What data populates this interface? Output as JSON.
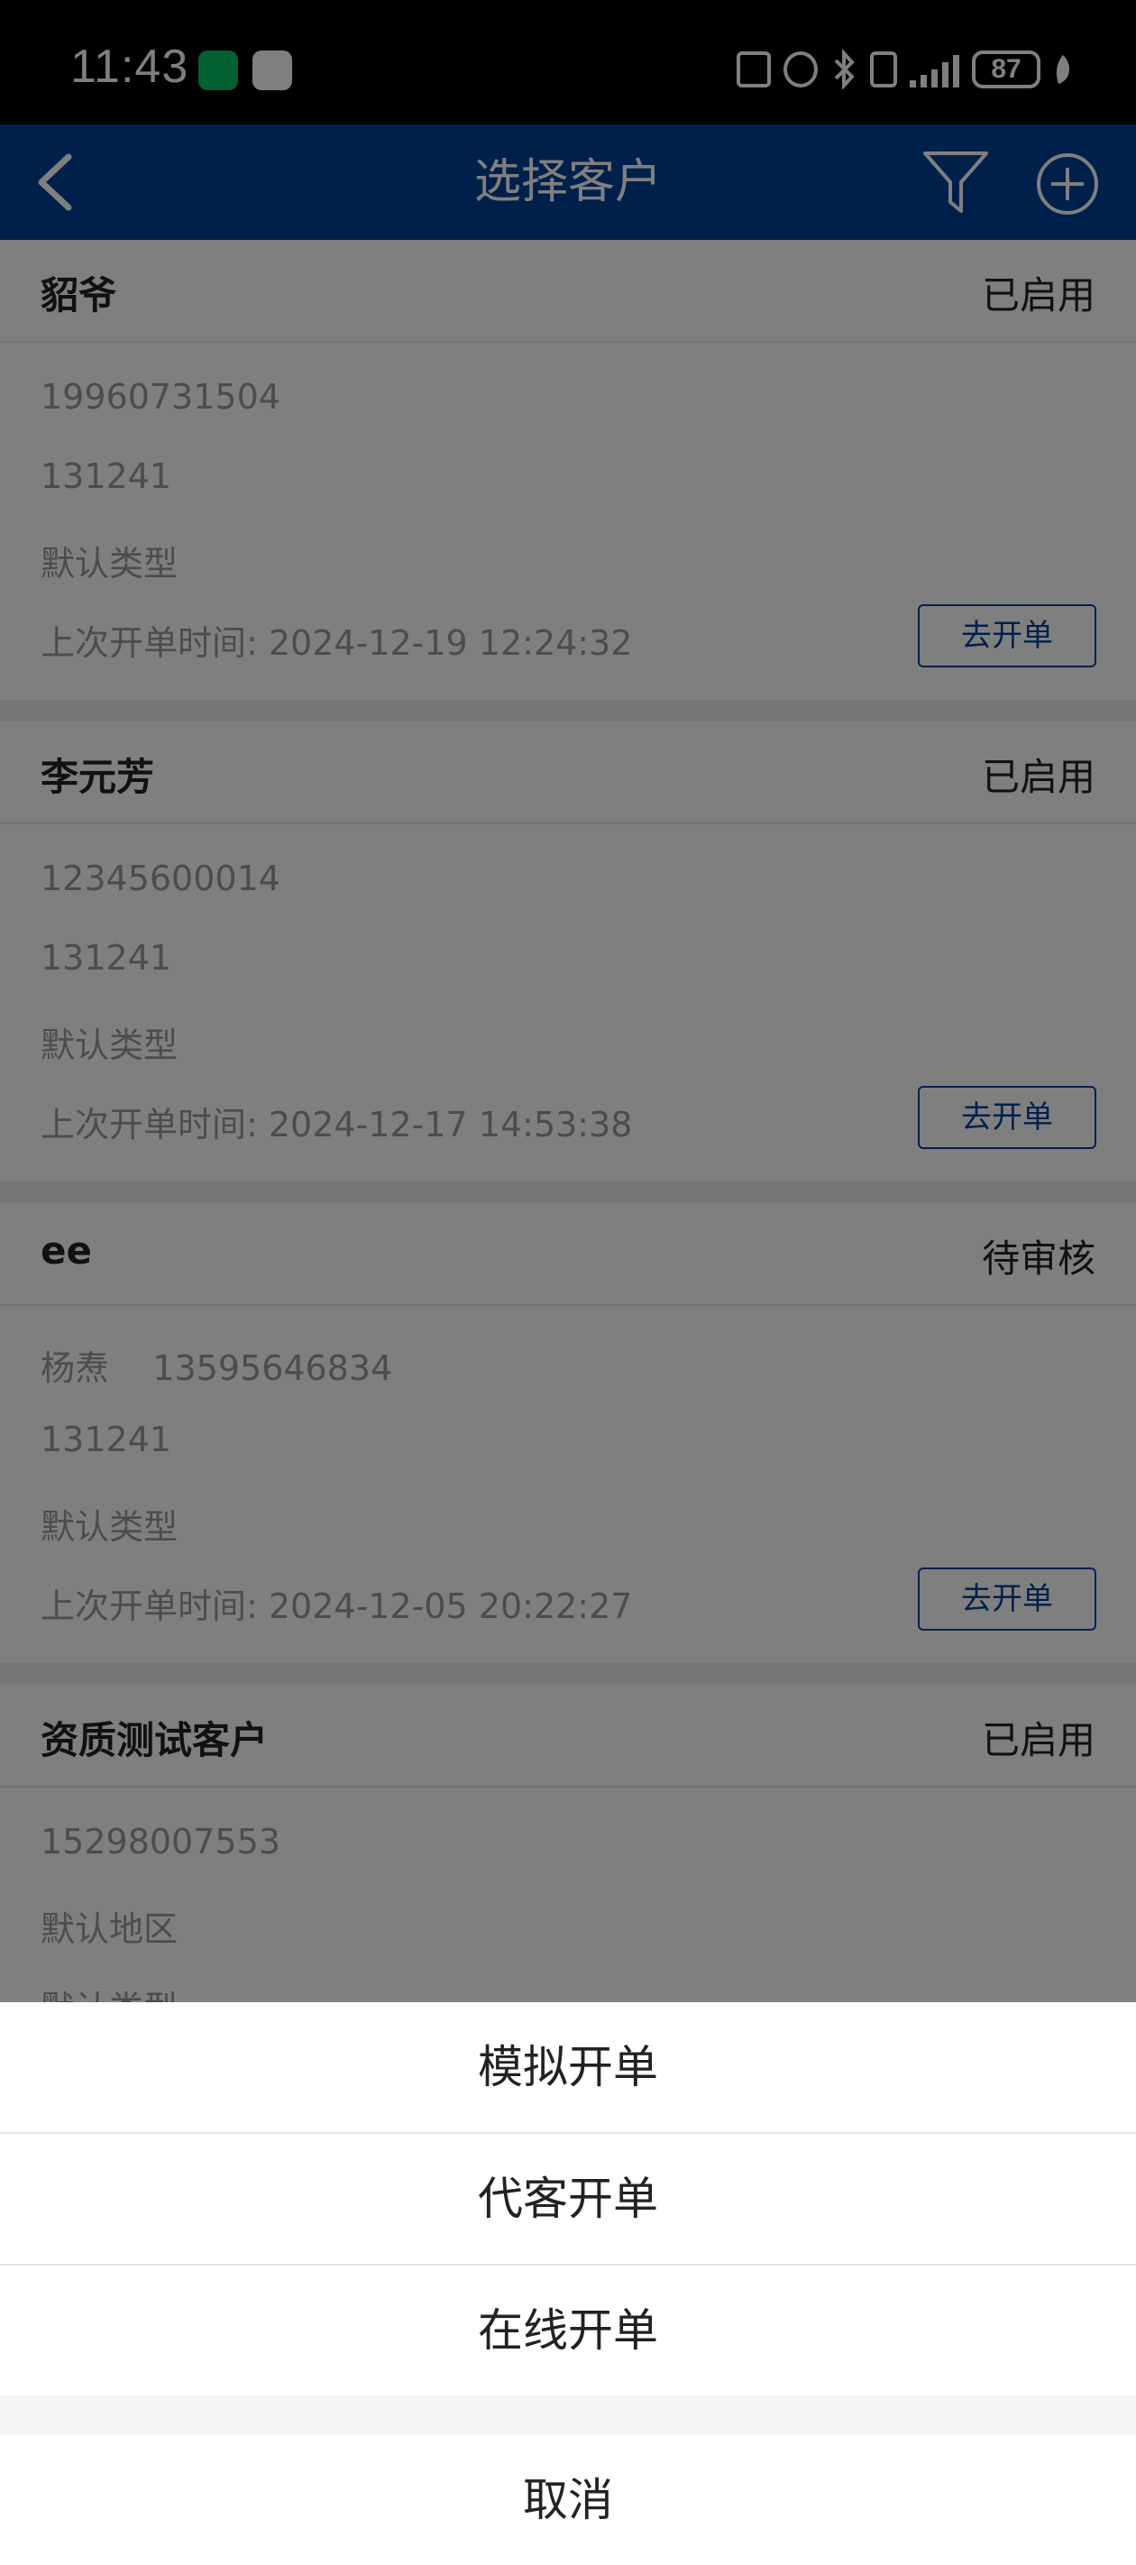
{
  "status_bar": {
    "time": "11:43",
    "battery": "87",
    "icons": [
      "wechat-icon",
      "message-icon",
      "nfc-icon",
      "alarm-icon",
      "bluetooth-icon",
      "vibrate-icon",
      "signal-icon",
      "battery-icon",
      "leaf-icon"
    ]
  },
  "nav": {
    "title": "选择客户",
    "icons": [
      "back-arrow-icon",
      "filter-icon",
      "add-circle-icon"
    ]
  },
  "customers": [
    {
      "name": "貂爷",
      "status": "已启用",
      "lines": [
        "19960731504",
        "131241",
        "默认类型"
      ],
      "last_order": "上次开单时间:  2024-12-19 12:24:32",
      "button": "去开单"
    },
    {
      "name": "李元芳",
      "status": "已启用",
      "lines": [
        "12345600014",
        "131241",
        "默认类型"
      ],
      "last_order": "上次开单时间:  2024-12-17 14:53:38",
      "button": "去开单"
    },
    {
      "name": "ee",
      "status": "待审核",
      "lines": [
        "杨焘    13595646834",
        "131241",
        "默认类型"
      ],
      "last_order": "上次开单时间:  2024-12-05 20:22:27",
      "button": "去开单"
    },
    {
      "name": "资质测试客户",
      "status": "已启用",
      "lines": [
        "15298007553",
        "默认地区",
        "默认类型"
      ]
    }
  ],
  "action_sheet": {
    "items": [
      "模拟开单",
      "代客开单",
      "在线开单"
    ],
    "cancel": "取消"
  },
  "colors": {
    "nav_background": "#004198",
    "button_accent": "#004198",
    "overlay": "rgba(0,0,0,0.5)"
  }
}
